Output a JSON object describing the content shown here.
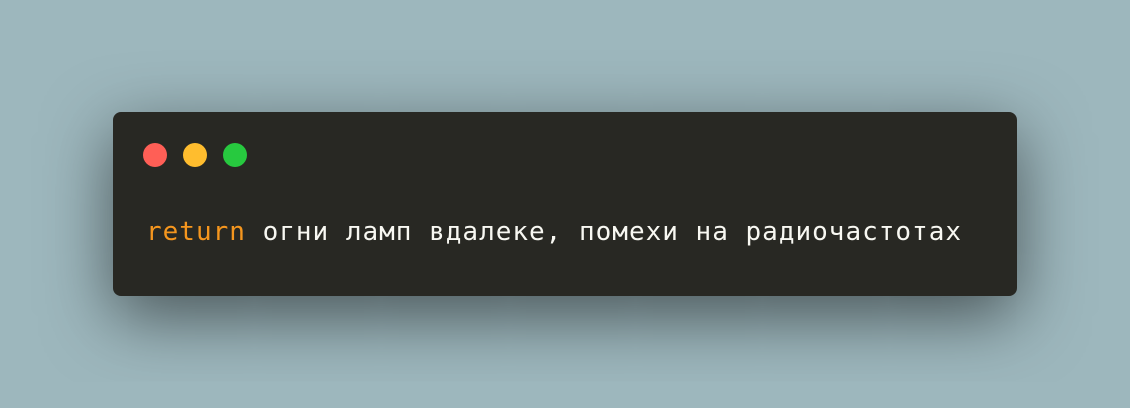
{
  "window": {
    "controls": [
      {
        "name": "close",
        "color": "#ff5f56"
      },
      {
        "name": "minimize",
        "color": "#ffbd2e"
      },
      {
        "name": "maximize",
        "color": "#27c93f"
      }
    ],
    "code": {
      "keyword": "return",
      "text": " огни ламп вдалеке, помехи на радиочастотах"
    }
  }
}
